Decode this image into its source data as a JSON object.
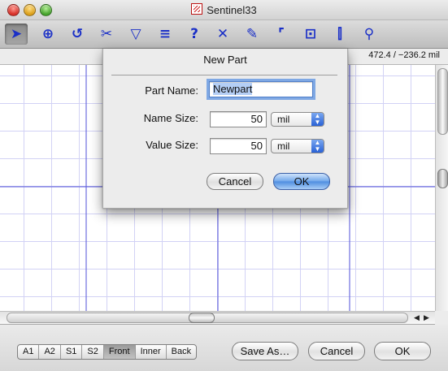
{
  "window": {
    "title": "Sentinel33"
  },
  "toolbar": {
    "tools": [
      {
        "name": "select-tool",
        "glyph": "➤"
      },
      {
        "name": "zoom-tool",
        "glyph": "⊕"
      },
      {
        "name": "rotate-tool",
        "glyph": "↺"
      },
      {
        "name": "cut-tool",
        "glyph": "✂"
      },
      {
        "name": "flip-tool",
        "glyph": "▽"
      },
      {
        "name": "bus-tool",
        "glyph": "≡"
      },
      {
        "name": "help-tool",
        "glyph": "?"
      },
      {
        "name": "delete-tool",
        "glyph": "✕"
      },
      {
        "name": "draw-tool",
        "glyph": "✎"
      },
      {
        "name": "corner-tool",
        "glyph": "⌜"
      },
      {
        "name": "via-tool",
        "glyph": "⊡"
      },
      {
        "name": "component-tool",
        "glyph": "⫿"
      },
      {
        "name": "probe-tool",
        "glyph": "⚲"
      }
    ]
  },
  "status": {
    "coords": "472.4 / −236.2 mil"
  },
  "layers": [
    "A1",
    "A2",
    "S1",
    "S2",
    "Front",
    "Inner",
    "Back"
  ],
  "layers_active": "Front",
  "footer": {
    "save_as": "Save As…",
    "cancel": "Cancel",
    "ok": "OK"
  },
  "dialog": {
    "title": "New Part",
    "part_name_label": "Part Name:",
    "part_name_value": "Newpart",
    "name_size_label": "Name Size:",
    "name_size_value": "50",
    "name_size_unit": "mil",
    "value_size_label": "Value Size:",
    "value_size_value": "50",
    "value_size_unit": "mil",
    "cancel": "Cancel",
    "ok": "OK"
  }
}
